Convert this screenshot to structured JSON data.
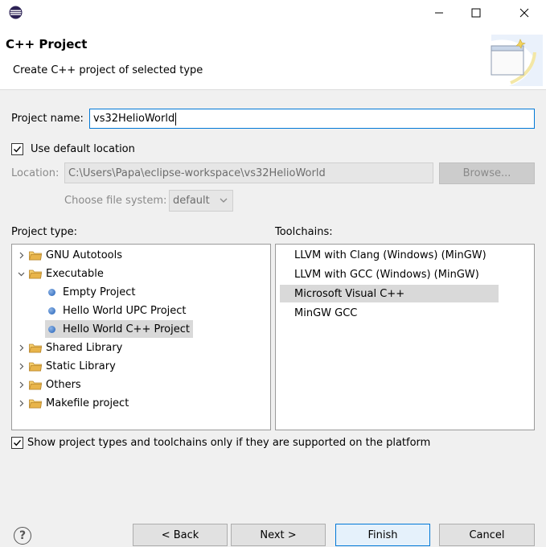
{
  "window": {
    "icon": "eclipse-icon",
    "controls": {
      "minimize": "minimize-icon",
      "maximize": "maximize-icon",
      "close": "close-icon"
    }
  },
  "header": {
    "title": "C++ Project",
    "description": "Create C++ project of selected type"
  },
  "form": {
    "project_name_label": "Project name:",
    "project_name_value": "vs32HelioWorld",
    "use_default_location_label": "Use default location",
    "use_default_location_checked": true,
    "location_label": "Location:",
    "location_value": "C:\\Users\\Papa\\eclipse-workspace\\vs32HelioWorld",
    "browse_label": "Browse...",
    "file_system_label": "Choose file system:",
    "file_system_value": "default"
  },
  "project_type": {
    "label": "Project type:",
    "items": [
      {
        "label": "GNU Autotools",
        "kind": "folder",
        "expanded": false,
        "depth": 0
      },
      {
        "label": "Executable",
        "kind": "folder",
        "expanded": true,
        "depth": 0
      },
      {
        "label": "Empty Project",
        "kind": "leaf",
        "depth": 1
      },
      {
        "label": "Hello World UPC Project",
        "kind": "leaf",
        "depth": 1
      },
      {
        "label": "Hello World C++ Project",
        "kind": "leaf",
        "depth": 1,
        "selected": true
      },
      {
        "label": "Shared Library",
        "kind": "folder",
        "expanded": false,
        "depth": 0
      },
      {
        "label": "Static Library",
        "kind": "folder",
        "expanded": false,
        "depth": 0
      },
      {
        "label": "Others",
        "kind": "folder",
        "expanded": false,
        "depth": 0
      },
      {
        "label": "Makefile project",
        "kind": "folder",
        "expanded": false,
        "depth": 0
      }
    ]
  },
  "toolchains": {
    "label": "Toolchains:",
    "items": [
      {
        "label": "LLVM with Clang (Windows) (MinGW)"
      },
      {
        "label": "LLVM with GCC (Windows) (MinGW)"
      },
      {
        "label": "Microsoft Visual C++",
        "selected": true
      },
      {
        "label": "MinGW GCC"
      }
    ]
  },
  "filter": {
    "label": "Show project types and toolchains only if they are supported on the platform",
    "checked": true
  },
  "buttons": {
    "help": "?",
    "back": "< Back",
    "next": "Next >",
    "finish": "Finish",
    "cancel": "Cancel"
  },
  "colors": {
    "accent": "#0078d7",
    "selection": "#d9d9d9",
    "folder": "#e8b44a"
  }
}
